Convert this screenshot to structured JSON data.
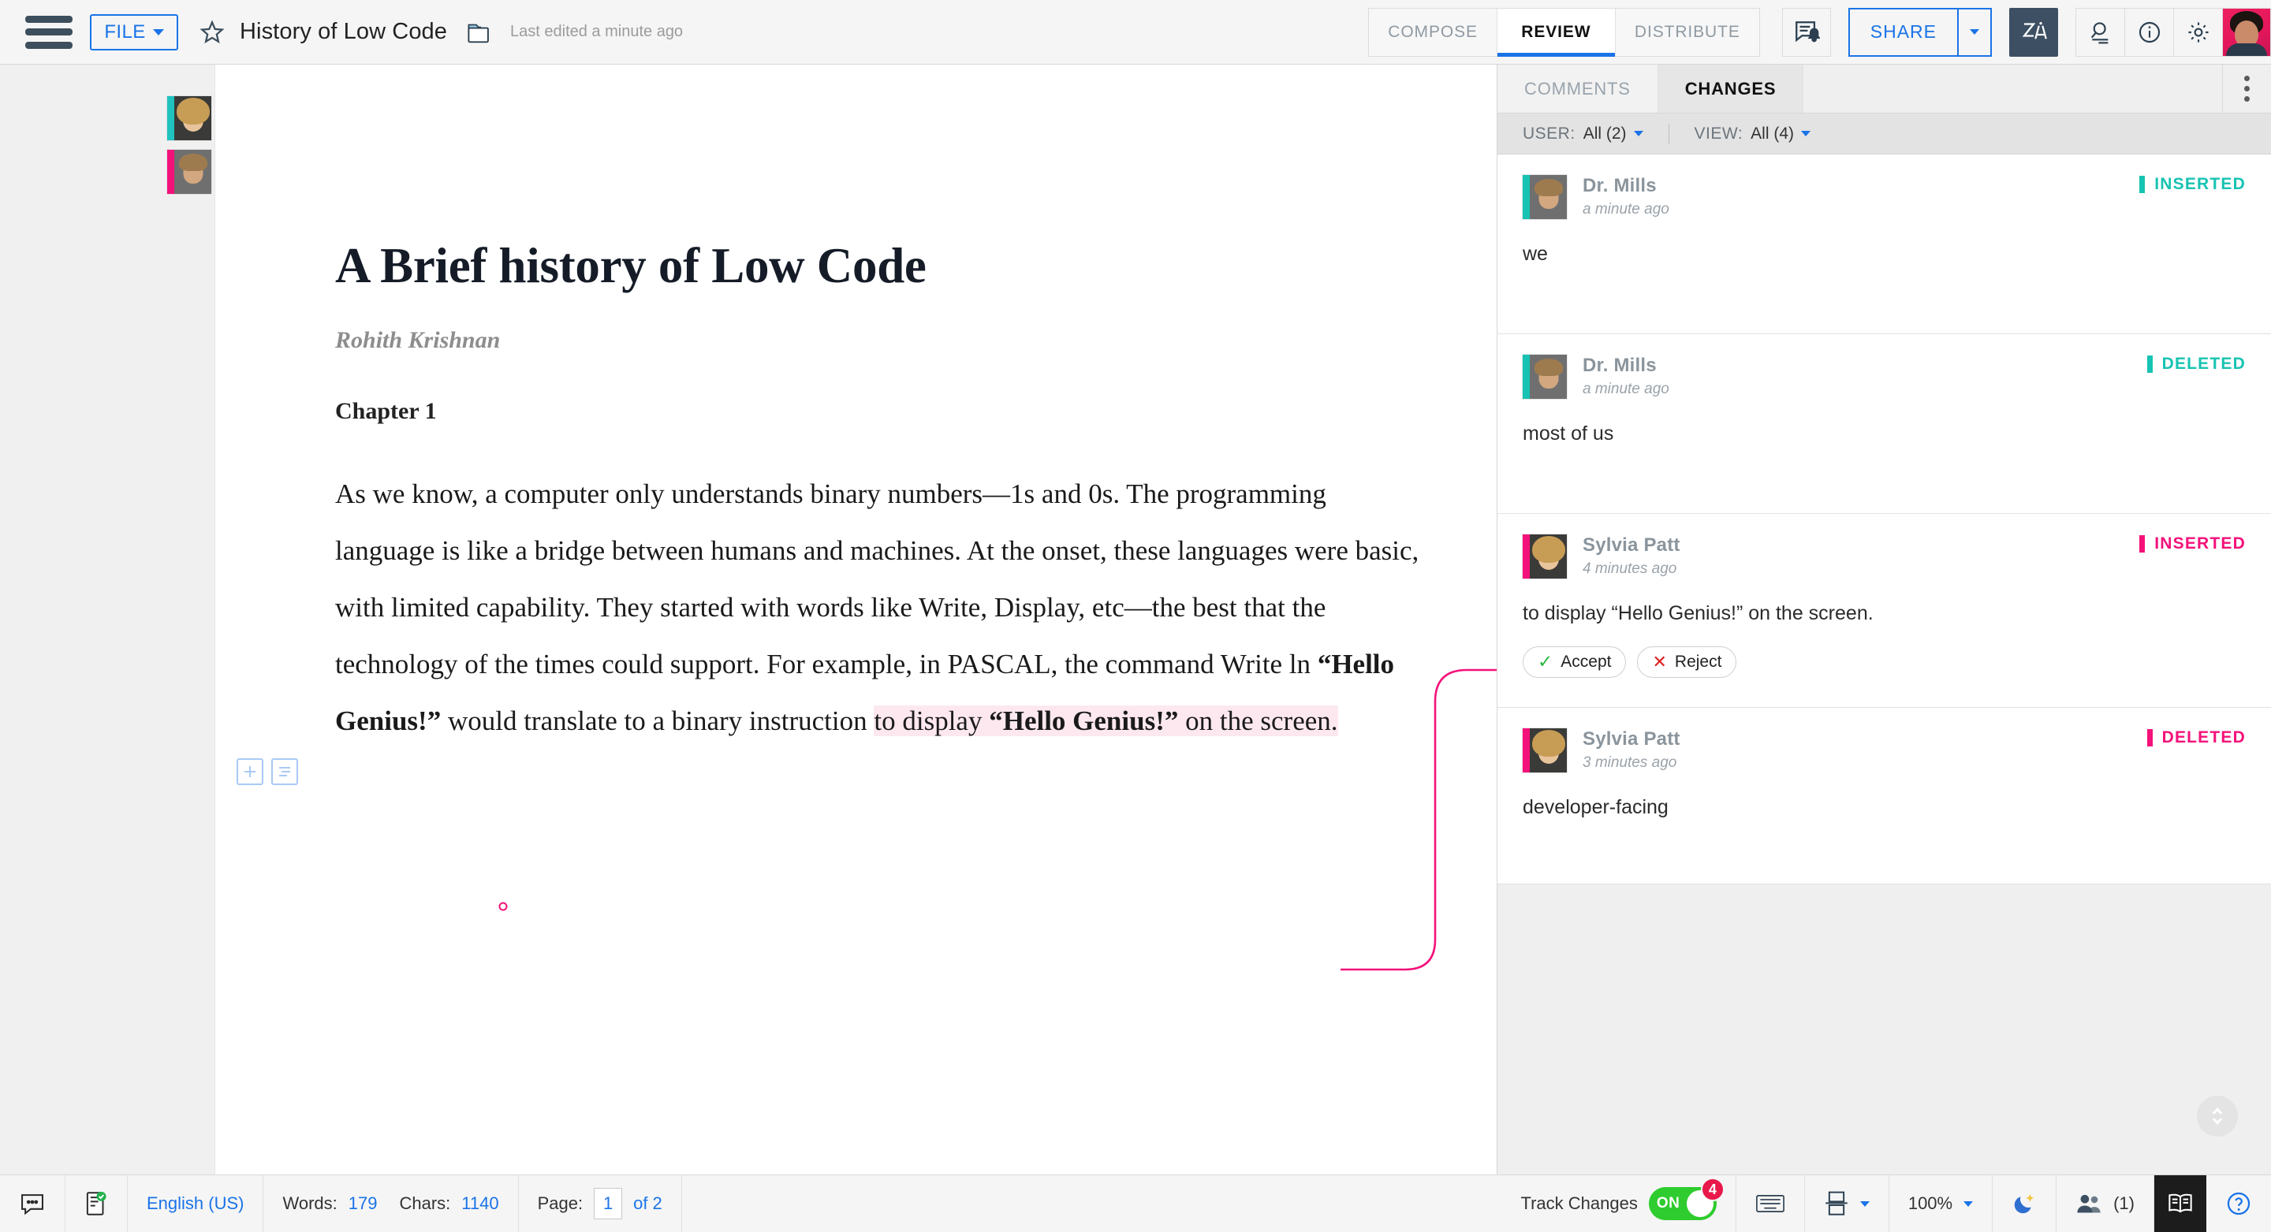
{
  "topbar": {
    "menu_icon": "hamburger-icon",
    "file_label": "FILE",
    "star_icon": "star-icon",
    "title": "History of Low Code",
    "folder_icon": "folder-icon",
    "last_edited": "Last edited a minute ago",
    "modes": [
      {
        "label": "COMPOSE",
        "active": false
      },
      {
        "label": "REVIEW",
        "active": true
      },
      {
        "label": "DISTRIBUTE",
        "active": false
      }
    ],
    "notify_icon": "comment-bell-icon",
    "share_label": "SHARE",
    "share_caret_icon": "chevron-down-icon",
    "za_icon": "translate-icon",
    "search_icon": "search-doc-icon",
    "info_icon": "info-icon",
    "settings_icon": "gear-icon",
    "profile_icon": "user-avatar"
  },
  "document": {
    "title": "A Brief history of Low Code",
    "author": "Rohith Krishnan",
    "chapter": "Chapter 1",
    "paragraph": {
      "p1": "As ",
      "ins1": "we",
      "p2": " know, a computer only understands binary numbers—1s and 0s. The programming language is like a bridge between humans and machines. At the onset, these languages were basic, with limited capability. They started with words like  Write,  Display, etc—the best that the technology of the times could support. For example, in  PASCAL, the command Write ln  ",
      "quote1": "“Hello Genius!”",
      "p3": " would translate to a binary instruction ",
      "hl1": "to display  ",
      "hl_quote": "“Hello Genius!”",
      "hl2": " on the screen."
    },
    "gutter_avatars": [
      {
        "name": "Sylvia Patt",
        "color": "#1fc3bf"
      },
      {
        "name": "Dr. Mills",
        "color": "#f4117a"
      }
    ],
    "para_tools": [
      {
        "icon": "plus-icon"
      },
      {
        "icon": "paragraph-list-icon"
      }
    ]
  },
  "panel": {
    "tabs": [
      {
        "label": "COMMENTS",
        "active": false
      },
      {
        "label": "CHANGES",
        "active": true
      }
    ],
    "kebab_icon": "more-vertical-icon",
    "filters": {
      "user_label": "USER:",
      "user_value": "All (2)",
      "view_label": "VIEW:",
      "view_value": "All (4)"
    },
    "changes": [
      {
        "author": "Dr. Mills",
        "time": "a minute ago",
        "status": "INSERTED",
        "status_color": "#17c3b2",
        "bar_color": "#17c3b2",
        "text": "we",
        "selected": false,
        "avatar": "mills",
        "actions": []
      },
      {
        "author": "Dr. Mills",
        "time": "a minute ago",
        "status": "DELETED",
        "status_color": "#17c3b2",
        "bar_color": "#17c3b2",
        "text": "most of us",
        "selected": false,
        "avatar": "mills",
        "actions": []
      },
      {
        "author": "Sylvia Patt",
        "time": "4 minutes ago",
        "status": "INSERTED",
        "status_color": "#f4117a",
        "bar_color": "#f4117a",
        "text": "to display “Hello Genius!” on the screen.",
        "selected": true,
        "avatar": "sylvia",
        "actions": [
          {
            "label": "Accept",
            "icon": "check-icon"
          },
          {
            "label": "Reject",
            "icon": "cross-icon"
          }
        ]
      },
      {
        "author": "Sylvia Patt",
        "time": "3 minutes ago",
        "status": "DELETED",
        "status_color": "#f4117a",
        "bar_color": "#f4117a",
        "text": "developer-facing",
        "selected": false,
        "avatar": "sylvia",
        "actions": []
      }
    ],
    "scroll_fab_icon": "chevron-up-down-icon"
  },
  "statusbar": {
    "comment_icon": "comment-icon",
    "spellcheck_icon": "spellcheck-icon",
    "language": "English (US)",
    "words_label": "Words:",
    "words_value": "179",
    "chars_label": "Chars:",
    "chars_value": "1140",
    "page_label": "Page:",
    "page_value": "1",
    "page_of": "of 2",
    "track_changes_label": "Track Changes",
    "track_changes_state": "ON",
    "track_changes_count": "4",
    "keyboard_icon": "keyboard-icon",
    "layout_icon": "page-layout-icon",
    "layout_caret_icon": "chevron-down-icon",
    "zoom_value": "100%",
    "zoom_caret_icon": "chevron-down-icon",
    "darkmode_icon": "moon-icon",
    "users_icon": "users-icon",
    "users_count": "(1)",
    "reading_icon": "book-icon",
    "help_icon": "help-icon"
  },
  "colors": {
    "accent_blue": "#1a73e8",
    "teal": "#17c3b2",
    "pink": "#f4117a",
    "green": "#2ecc2e"
  }
}
